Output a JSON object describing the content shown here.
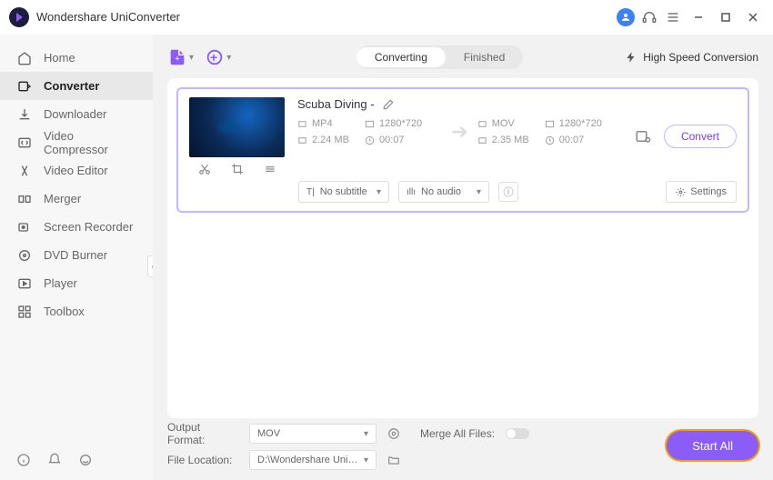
{
  "app": {
    "title": "Wondershare UniConverter"
  },
  "sidebar": {
    "items": [
      {
        "label": "Home",
        "icon": "home-icon"
      },
      {
        "label": "Converter",
        "icon": "converter-icon"
      },
      {
        "label": "Downloader",
        "icon": "downloader-icon"
      },
      {
        "label": "Video Compressor",
        "icon": "compressor-icon"
      },
      {
        "label": "Video Editor",
        "icon": "editor-icon"
      },
      {
        "label": "Merger",
        "icon": "merger-icon"
      },
      {
        "label": "Screen Recorder",
        "icon": "recorder-icon"
      },
      {
        "label": "DVD Burner",
        "icon": "dvd-icon"
      },
      {
        "label": "Player",
        "icon": "player-icon"
      },
      {
        "label": "Toolbox",
        "icon": "toolbox-icon"
      }
    ],
    "active_index": 1
  },
  "tabs": {
    "converting": "Converting",
    "finished": "Finished",
    "active": "Converting"
  },
  "high_speed": "High Speed Conversion",
  "file": {
    "name": "Scuba Diving -",
    "source": {
      "format": "MP4",
      "resolution": "1280*720",
      "size": "2.24 MB",
      "duration": "00:07"
    },
    "target": {
      "format": "MOV",
      "resolution": "1280*720",
      "size": "2.35 MB",
      "duration": "00:07"
    },
    "subtitle": "No subtitle",
    "audio": "No audio",
    "convert_btn": "Convert",
    "settings_btn": "Settings"
  },
  "footer": {
    "output_format_label": "Output Format:",
    "output_format": "MOV",
    "file_location_label": "File Location:",
    "file_location": "D:\\Wondershare UniConverter",
    "merge_label": "Merge All Files:",
    "start_all": "Start All"
  }
}
